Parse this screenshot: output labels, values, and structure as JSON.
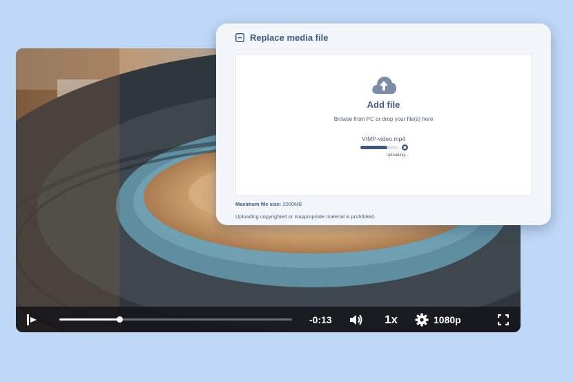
{
  "player": {
    "time_remaining": "-0:13",
    "speed": "1x",
    "quality": "1080p",
    "progress_fraction": 0.26
  },
  "upload_dialog": {
    "title": "Replace media file",
    "add_file_label": "Add file",
    "instructions": "Browse from PC or drop your file(s) here",
    "file_name": "VIMP-video.mp4",
    "upload_progress_fraction": 0.7,
    "status": "Uploading...",
    "max_size_label": "Maximum file size:",
    "max_size_value": "2000MB",
    "notice": "Uploading copyrighted or inappropriate material is prohibited."
  },
  "colors": {
    "background": "#bfd8f7",
    "accent": "#3e5a82",
    "control_bar": "#14161a"
  },
  "icons": [
    "play-icon",
    "volume-icon",
    "gear-icon",
    "fullscreen-icon",
    "collapse-icon",
    "cloud-upload-icon",
    "cancel-icon"
  ]
}
